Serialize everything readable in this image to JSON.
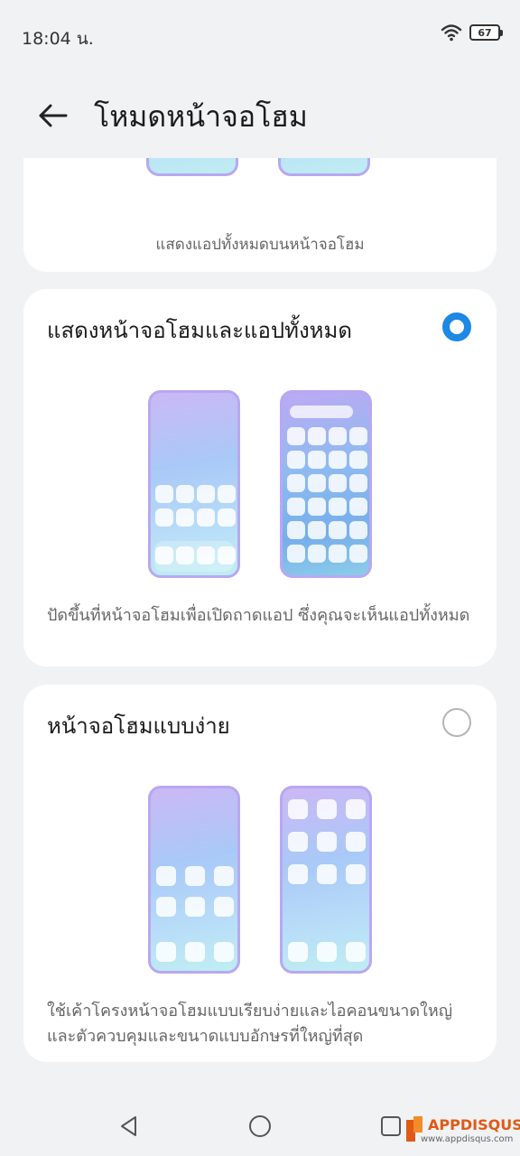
{
  "status_bar": {
    "time": "18:04 น.",
    "battery": "67"
  },
  "header": {
    "title": "โหมดหน้าจอโฮม"
  },
  "options": [
    {
      "description": "แสดงแอปทั้งหมดบนหน้าจอโฮม",
      "selected": false
    },
    {
      "title": "แสดงหน้าจอโฮมและแอปทั้งหมด",
      "description": "ปัดขึ้นที่หน้าจอโฮมเพื่อเปิดถาดแอป ซึ่งคุณจะเห็นแอปทั้งหมด",
      "selected": true
    },
    {
      "title": "หน้าจอโฮมแบบง่าย",
      "description": "ใช้เค้าโครงหน้าจอโฮมแบบเรียบง่ายและไอคอนขนาดใหญ่และตัวควบคุมและขนาดแบบอักษรที่ใหญ่ที่สุด",
      "selected": false
    }
  ],
  "nav": {
    "back_icon": "triangle-back-icon",
    "home_icon": "circle-home-icon",
    "recents_icon": "square-recents-icon"
  },
  "watermark": {
    "logo": "APPDISQUS",
    "url": "www.appdisqus.com"
  },
  "colors": {
    "accent": "#1e88e5",
    "background": "#f1f2f4",
    "card": "#ffffff"
  }
}
